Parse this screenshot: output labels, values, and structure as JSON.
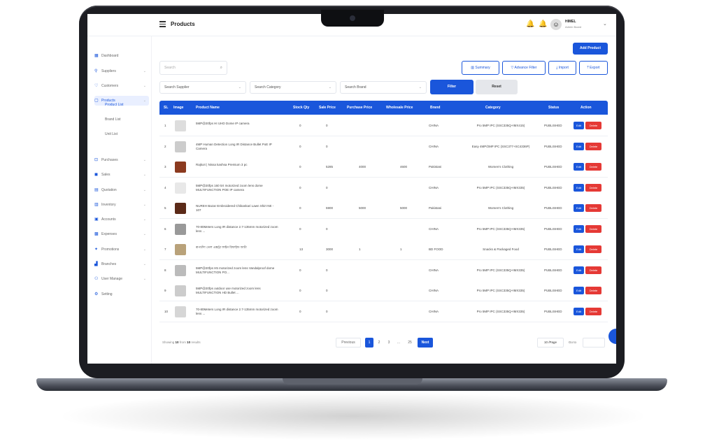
{
  "topbar": {
    "title": "Products",
    "user_name": "HIMEL",
    "user_role": "Admin Board"
  },
  "sidebar": {
    "items": [
      {
        "label": "Dashboard",
        "icon": "grid-icon",
        "glyph": "▦"
      },
      {
        "label": "Suppliers",
        "icon": "location-icon",
        "glyph": "⚲"
      },
      {
        "label": "Customers",
        "icon": "heart-icon",
        "glyph": "♡"
      },
      {
        "label": "Products",
        "icon": "box-icon",
        "glyph": "▢"
      },
      {
        "label": "Purchases",
        "icon": "cart-icon",
        "glyph": "⊡"
      },
      {
        "label": "Sales",
        "icon": "bag-icon",
        "glyph": "◼"
      },
      {
        "label": "Quotation",
        "icon": "doc-icon",
        "glyph": "▤"
      },
      {
        "label": "Inventory",
        "icon": "stack-icon",
        "glyph": "▥"
      },
      {
        "label": "Accounts",
        "icon": "wallet-icon",
        "glyph": "▣"
      },
      {
        "label": "Expenses",
        "icon": "expense-icon",
        "glyph": "▩"
      },
      {
        "label": "Promotions",
        "icon": "megaphone-icon",
        "glyph": "✦"
      },
      {
        "label": "Branches",
        "icon": "branch-icon",
        "glyph": "▟"
      },
      {
        "label": "User Manage",
        "icon": "users-icon",
        "glyph": "⚇"
      },
      {
        "label": "Setting",
        "icon": "gear-icon",
        "glyph": "⚙"
      }
    ],
    "sub_items": [
      "Product List",
      "Brand List",
      "Unit List"
    ]
  },
  "toolbar": {
    "add_label": "Add Product",
    "search_placeholder": "Search",
    "summary_label": "Summary",
    "advance_filter_label": "Advance Filter",
    "import_label": "Import",
    "export_label": "Export",
    "supplier_select": "Search Supplier",
    "category_select": "Search Category",
    "brand_select": "Search Brand",
    "filter_label": "Filter",
    "reset_label": "Reset"
  },
  "table": {
    "headers": [
      "SL",
      "Image",
      "Product Name",
      "Stock Qty",
      "Sale Price",
      "Purchase Price",
      "Wholesale Price",
      "Brand",
      "Category",
      "Status",
      "Action"
    ],
    "edit_label": "Edit",
    "delete_label": "Delete",
    "rows": [
      {
        "sl": "1",
        "name": "5MP@20fps HI UHD Dome IP camera",
        "stock": "0",
        "sale": "0",
        "purchase": "",
        "wholesale": "",
        "brand": "CHINA",
        "category": "Pro 5MP IPC (SSC335Q+IMX415)",
        "status": "PUBLISHED"
      },
      {
        "sl": "2",
        "name": "4MP Human Detection Long IR Distance Bullet PoE IP Camera",
        "stock": "0",
        "sale": "0",
        "purchase": "",
        "wholesale": "",
        "brand": "CHINA",
        "category": "Easy 4MP/2MP IPC (SSC377+SC4336P)",
        "status": "PUBLISHED"
      },
      {
        "sl": "3",
        "name": "Rajkori | Nissa kashsa Premium 3 pc",
        "stock": "0",
        "sale": "5285",
        "purchase": "4000",
        "wholesale": "4600",
        "brand": "Pakistani",
        "category": "Women's Clothing",
        "status": "PUBLISHED"
      },
      {
        "sl": "4",
        "name": "5MP@20fps 160 5X motorized zoom lens dome MULTIFUNCTION POE IP camera",
        "stock": "0",
        "sale": "0",
        "purchase": "",
        "wholesale": "",
        "brand": "CHINA",
        "category": "Pro 5MP IPC (SSC335Q+IMX335)",
        "status": "PUBLISHED"
      },
      {
        "sl": "5",
        "name": "NUREH Bazar Embroidered Chikankari Lawn Shirt NE - 107",
        "stock": "0",
        "sale": "5900",
        "purchase": "5000",
        "wholesale": "5000",
        "brand": "Pakistani",
        "category": "Women's Clothing",
        "status": "PUBLISHED"
      },
      {
        "sl": "6",
        "name": "70-80Meters Long IR distance 2.7-135mm motorized zoom lens ...",
        "stock": "0",
        "sale": "0",
        "purchase": "",
        "wholesale": "",
        "brand": "CHINA",
        "category": "Pro 5MP IPC (SSC335Q+IMX335)",
        "status": "PUBLISHED"
      },
      {
        "sl": "7",
        "name": "রূপচাঁদা তেল এক্সট্রা ফাইন রিফাইন্ড আটা",
        "stock": "13",
        "sale": "3000",
        "purchase": "1",
        "wholesale": "1",
        "brand": "BD FOOD",
        "category": "Snacks & Packaged Food",
        "status": "PUBLISHED"
      },
      {
        "sl": "8",
        "name": "5MP@20fps H5 motorized zoom lens Vandalproof dome MULTIFUNCTION PO...",
        "stock": "0",
        "sale": "0",
        "purchase": "",
        "wholesale": "",
        "brand": "CHINA",
        "category": "Pro 5MP IPC (SSC335Q+IMX335)",
        "status": "PUBLISHED"
      },
      {
        "sl": "9",
        "name": "5MP@20fps outdoor use motorized zoom lens MULTIFUNCTION HD Bullet ...",
        "stock": "0",
        "sale": "0",
        "purchase": "",
        "wholesale": "",
        "brand": "CHINA",
        "category": "Pro 5MP IPC (SSC335Q+IMX335)",
        "status": "PUBLISHED"
      },
      {
        "sl": "10",
        "name": "70-80Meters Long IR distance 2.7-135mm motorized zoom lens ...",
        "stock": "0",
        "sale": "0",
        "purchase": "",
        "wholesale": "",
        "brand": "CHINA",
        "category": "Pro 5MP IPC (SSC335Q+IMX335)",
        "status": "PUBLISHED"
      }
    ]
  },
  "footer": {
    "showing_prefix": "Showing",
    "showing_count": "10",
    "showing_mid": "from",
    "showing_total": "10",
    "showing_suffix": "results",
    "previous_label": "Previous",
    "pages": [
      "1",
      "2",
      "3",
      "...",
      "25"
    ],
    "next_label": "Next",
    "per_page": "10 /Page",
    "goto_label": "Go to"
  },
  "colors": {
    "accent": "#1a56db",
    "danger": "#e53935"
  }
}
